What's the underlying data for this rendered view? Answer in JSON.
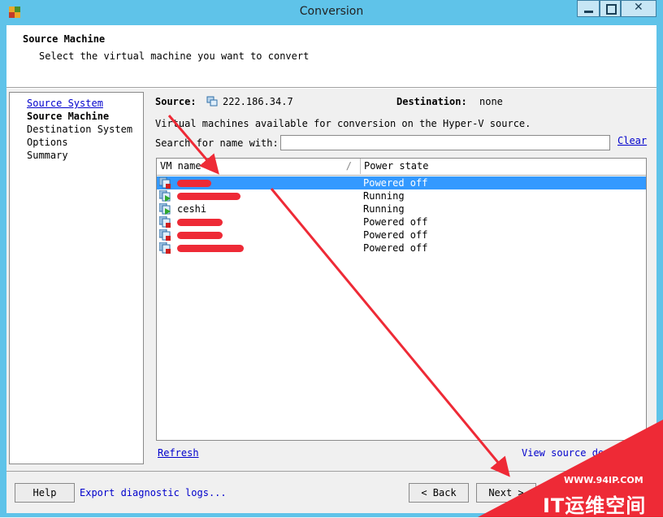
{
  "window": {
    "title": "Conversion",
    "min_glyph": "▁",
    "max_glyph": "□",
    "close_glyph": "✕"
  },
  "header": {
    "title": "Source Machine",
    "subtitle": "Select the virtual machine you want to convert"
  },
  "nav": {
    "items": [
      {
        "label": "Source System",
        "state": "link"
      },
      {
        "label": "Source Machine",
        "state": "current"
      },
      {
        "label": "Destination System",
        "state": "normal"
      },
      {
        "label": "Options",
        "state": "normal"
      },
      {
        "label": "Summary",
        "state": "normal"
      }
    ]
  },
  "source": {
    "label": "Source:",
    "value": "222.186.34.7",
    "icon": "network-server-icon"
  },
  "destination": {
    "label": "Destination:",
    "value": "none"
  },
  "available_text": "Virtual machines available for conversion on the Hyper-V source.",
  "search": {
    "label": "Search for name with:",
    "value": "",
    "clear_label": "Clear"
  },
  "table": {
    "columns": [
      "VM name",
      "Power state"
    ],
    "sort_indicator": "/",
    "rows": [
      {
        "name": "",
        "redacted": true,
        "state": "Powered off",
        "selected": true
      },
      {
        "name": "",
        "redacted": true,
        "state": "Running"
      },
      {
        "name": "ceshi",
        "redacted": false,
        "state": "Running"
      },
      {
        "name": "",
        "redacted": true,
        "state": "Powered off"
      },
      {
        "name": "",
        "redacted": true,
        "state": "Powered off"
      },
      {
        "name": "",
        "redacted": true,
        "state": "Powered off"
      }
    ]
  },
  "links": {
    "refresh": "Refresh",
    "view_source": "View source de"
  },
  "footer": {
    "help": "Help",
    "export_logs": "Export diagnostic logs...",
    "back": "< Back",
    "next": "Next >"
  },
  "watermark": {
    "url": "WWW.94IP.COM",
    "brand": "IT运维空间"
  },
  "colors": {
    "accent_red": "#ee2a36",
    "selection": "#3399ff",
    "frame": "#5fc3e9"
  }
}
